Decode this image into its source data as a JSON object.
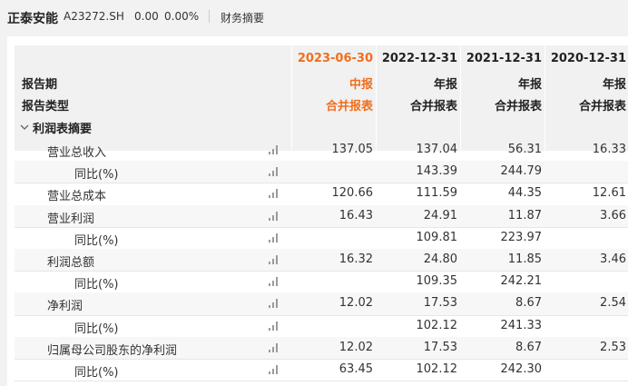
{
  "header": {
    "stock_name": "正泰安能",
    "stock_code": "A23272.SH",
    "price": "0.00",
    "change_pct": "0.00%",
    "tab": "财务摘要"
  },
  "table": {
    "columns": [
      "2023-06-30",
      "2022-12-31",
      "2021-12-31",
      "2020-12-31"
    ],
    "report_period_label": "报告期",
    "report_type_label": "报告类型",
    "period_types": [
      "中报",
      "年报",
      "年报",
      "年报"
    ],
    "report_types": [
      "合并报表",
      "合并报表",
      "合并报表",
      "合并报表"
    ],
    "section_title": "利润表摘要",
    "rows": [
      {
        "label": "营业总收入",
        "sub": false,
        "values": [
          "137.05",
          "137.04",
          "56.31",
          "16.33"
        ]
      },
      {
        "label": "同比(%)",
        "sub": true,
        "values": [
          "",
          "143.39",
          "244.79",
          ""
        ]
      },
      {
        "label": "营业总成本",
        "sub": false,
        "values": [
          "120.66",
          "111.59",
          "44.35",
          "12.61"
        ]
      },
      {
        "label": "营业利润",
        "sub": false,
        "values": [
          "16.43",
          "24.91",
          "11.87",
          "3.66"
        ]
      },
      {
        "label": "同比(%)",
        "sub": true,
        "values": [
          "",
          "109.81",
          "223.97",
          ""
        ]
      },
      {
        "label": "利润总额",
        "sub": false,
        "values": [
          "16.32",
          "24.80",
          "11.85",
          "3.46"
        ]
      },
      {
        "label": "同比(%)",
        "sub": true,
        "values": [
          "",
          "109.35",
          "242.21",
          ""
        ]
      },
      {
        "label": "净利润",
        "sub": false,
        "values": [
          "12.02",
          "17.53",
          "8.67",
          "2.54"
        ]
      },
      {
        "label": "同比(%)",
        "sub": true,
        "values": [
          "",
          "102.12",
          "241.33",
          ""
        ]
      },
      {
        "label": "归属母公司股东的净利润",
        "sub": false,
        "values": [
          "12.02",
          "17.53",
          "8.67",
          "2.53"
        ]
      },
      {
        "label": "同比(%)",
        "sub": true,
        "values": [
          "63.45",
          "102.12",
          "242.30",
          ""
        ]
      }
    ]
  },
  "colors": {
    "highlight": "#f26d1b",
    "header_bg": "#f1f1f1"
  }
}
